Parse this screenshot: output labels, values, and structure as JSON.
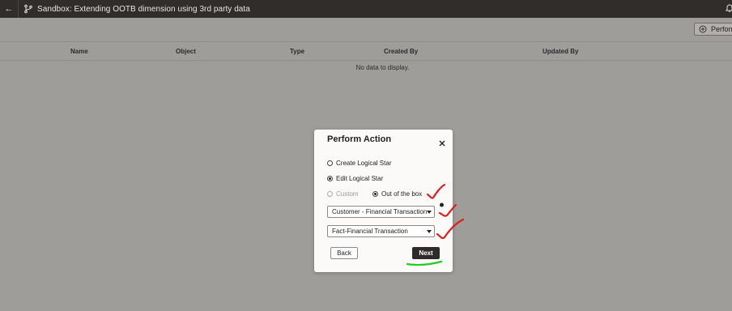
{
  "topbar": {
    "title": "Sandbox: Extending OOTB dimension using 3rd party data"
  },
  "toolbar": {
    "perform_label": "Perform"
  },
  "table": {
    "columns": [
      "Name",
      "Object",
      "Type",
      "Created By",
      "Updated By"
    ],
    "empty_text": "No data to display."
  },
  "dialog": {
    "title": "Perform Action",
    "options": {
      "create": "Create Logical Star",
      "edit": "Edit Logical Star",
      "custom": "Custom",
      "ootb": "Out of the box"
    },
    "selected_option": "edit",
    "selected_source": "ootb",
    "dimension_select_value": "Customer - Financial Transaction",
    "fact_select_value": "Fact-Financial Transaction",
    "back_label": "Back",
    "next_label": "Next"
  },
  "icons": {
    "back": "arrow-left-icon",
    "branch": "branch-icon",
    "bell": "bell-icon",
    "plus": "plus-circle-icon",
    "close": "close-icon",
    "info": "info-icon",
    "caret": "caret-down-icon"
  },
  "colors": {
    "topbar_bg": "#312d2a",
    "overlay_bg": "#9f9d9a",
    "dialog_bg": "#fbfaf9",
    "primary_button": "#2f2b28",
    "annotation_red": "#e11d1d",
    "annotation_green": "#22cc22"
  }
}
